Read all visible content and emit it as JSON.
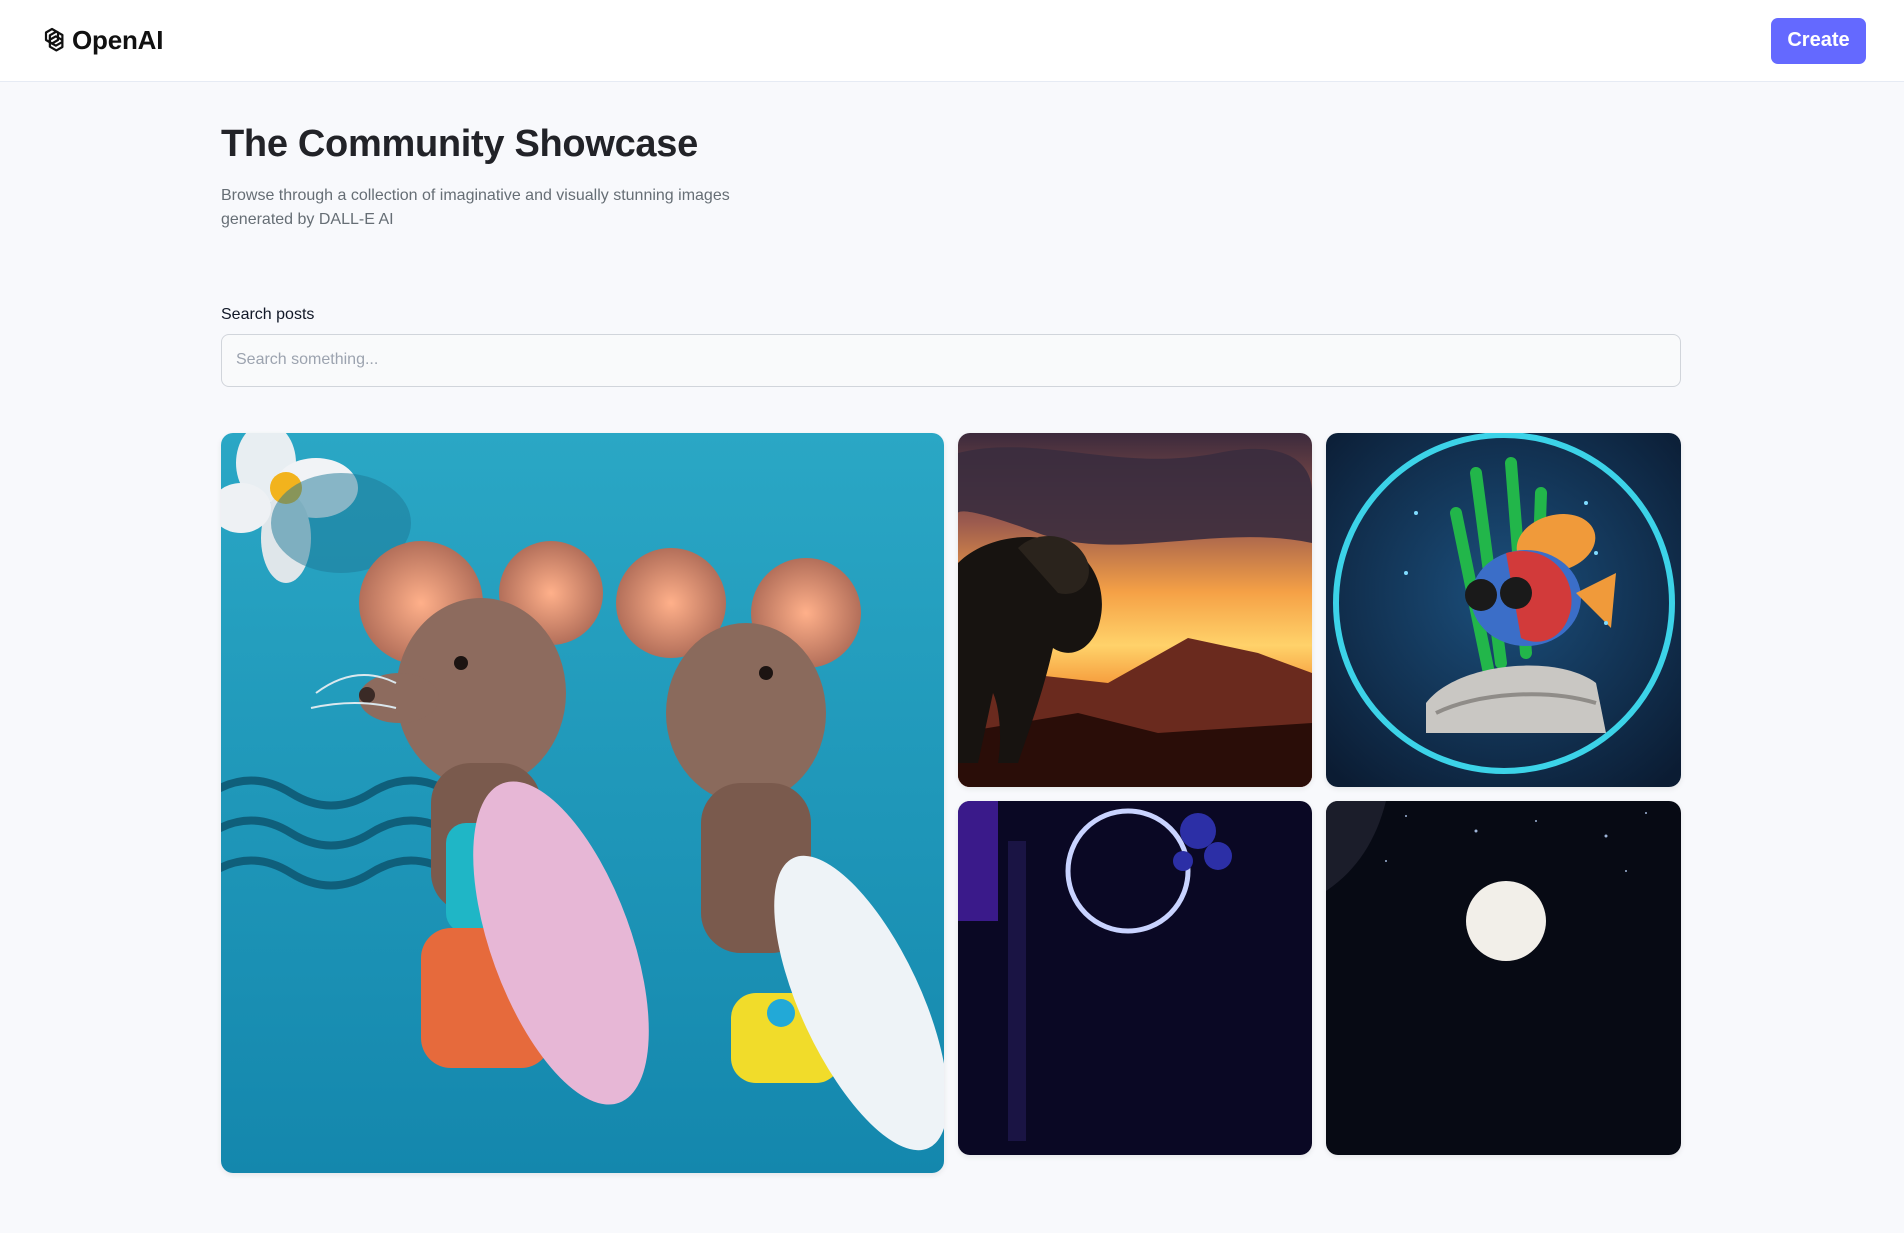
{
  "header": {
    "brand_name": "OpenAI",
    "brand_icon": "openai-logo-icon",
    "create_label": "Create",
    "accent_color": "#6469ff"
  },
  "main": {
    "title": "The Community Showcase",
    "subtitle": "Browse through a collection of imaginative and visually stunning images generated by DALL-E AI",
    "search": {
      "label": "Search posts",
      "placeholder": "Search something...",
      "value": ""
    }
  },
  "gallery": {
    "items": [
      {
        "subject": "two mice with surfboards"
      },
      {
        "subject": "lion at sunset"
      },
      {
        "subject": "fish in fishbowl"
      },
      {
        "subject": "neon night scene"
      },
      {
        "subject": "moon in starry space"
      }
    ]
  }
}
